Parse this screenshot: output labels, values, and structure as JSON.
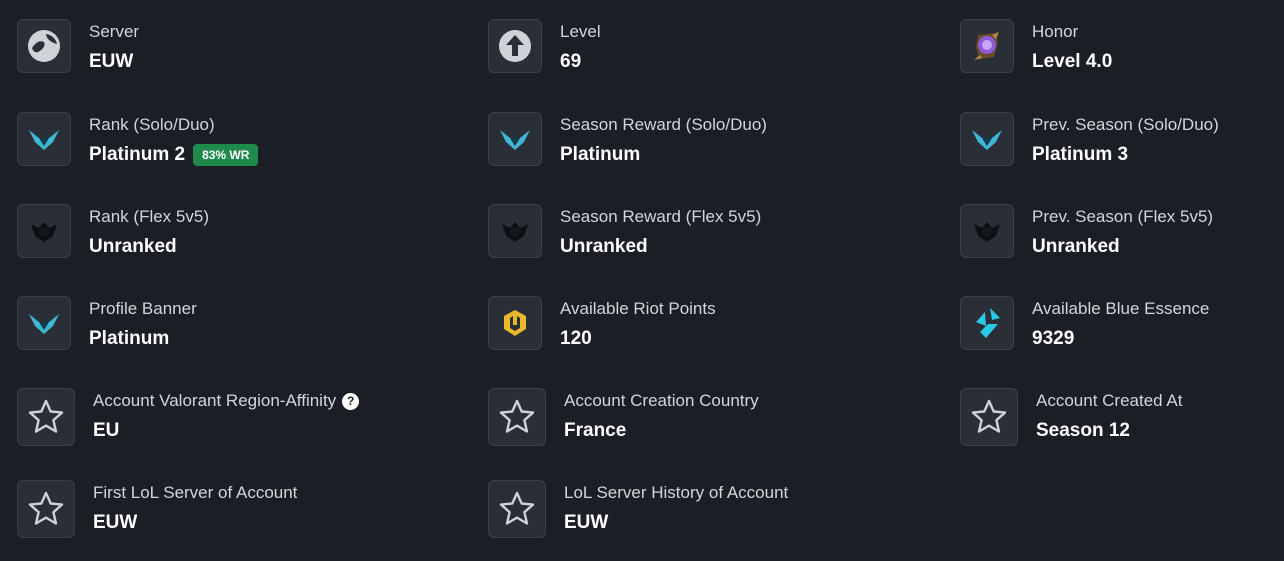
{
  "colors": {
    "background": "#1b1e24",
    "icon_box": "#2a2e36",
    "badge": "#1f8a4c",
    "platinum_crest": "#3fb6d6",
    "unranked_crest": "#0d0f12",
    "riot_points": "#e8b82a",
    "blue_essence": "#27c9e6"
  },
  "items": [
    {
      "label": "Server",
      "value": "EUW",
      "icon": "globe-icon"
    },
    {
      "label": "Level",
      "value": "69",
      "icon": "level-up-arrow-icon"
    },
    {
      "label": "Honor",
      "value": "Level 4.0",
      "icon": "honor-emblem-icon"
    },
    {
      "label": "Rank (Solo/Duo)",
      "value": "Platinum 2",
      "badge": "83% WR",
      "icon": "platinum-crest-icon"
    },
    {
      "label": "Season Reward (Solo/Duo)",
      "value": "Platinum",
      "icon": "platinum-crest-icon"
    },
    {
      "label": "Prev. Season (Solo/Duo)",
      "value": "Platinum 3",
      "icon": "platinum-crest-icon"
    },
    {
      "label": "Rank (Flex 5v5)",
      "value": "Unranked",
      "icon": "unranked-crest-icon"
    },
    {
      "label": "Season Reward (Flex 5v5)",
      "value": "Unranked",
      "icon": "unranked-crest-icon"
    },
    {
      "label": "Prev. Season (Flex 5v5)",
      "value": "Unranked",
      "icon": "unranked-crest-icon"
    },
    {
      "label": "Profile Banner",
      "value": "Platinum",
      "icon": "platinum-crest-icon"
    },
    {
      "label": "Available Riot Points",
      "value": "120",
      "icon": "riot-points-icon"
    },
    {
      "label": "Available Blue Essence",
      "value": "9329",
      "icon": "blue-essence-icon"
    },
    {
      "label": "Account Valorant Region-Affinity",
      "value": "EU",
      "icon": "star-icon",
      "help": "?"
    },
    {
      "label": "Account Creation Country",
      "value": "France",
      "icon": "star-icon"
    },
    {
      "label": "Account Created At",
      "value": "Season 12",
      "icon": "star-icon"
    },
    {
      "label": "First LoL Server of Account",
      "value": "EUW",
      "icon": "star-icon"
    },
    {
      "label": "LoL Server History of Account",
      "value": "EUW",
      "icon": "star-icon"
    }
  ]
}
